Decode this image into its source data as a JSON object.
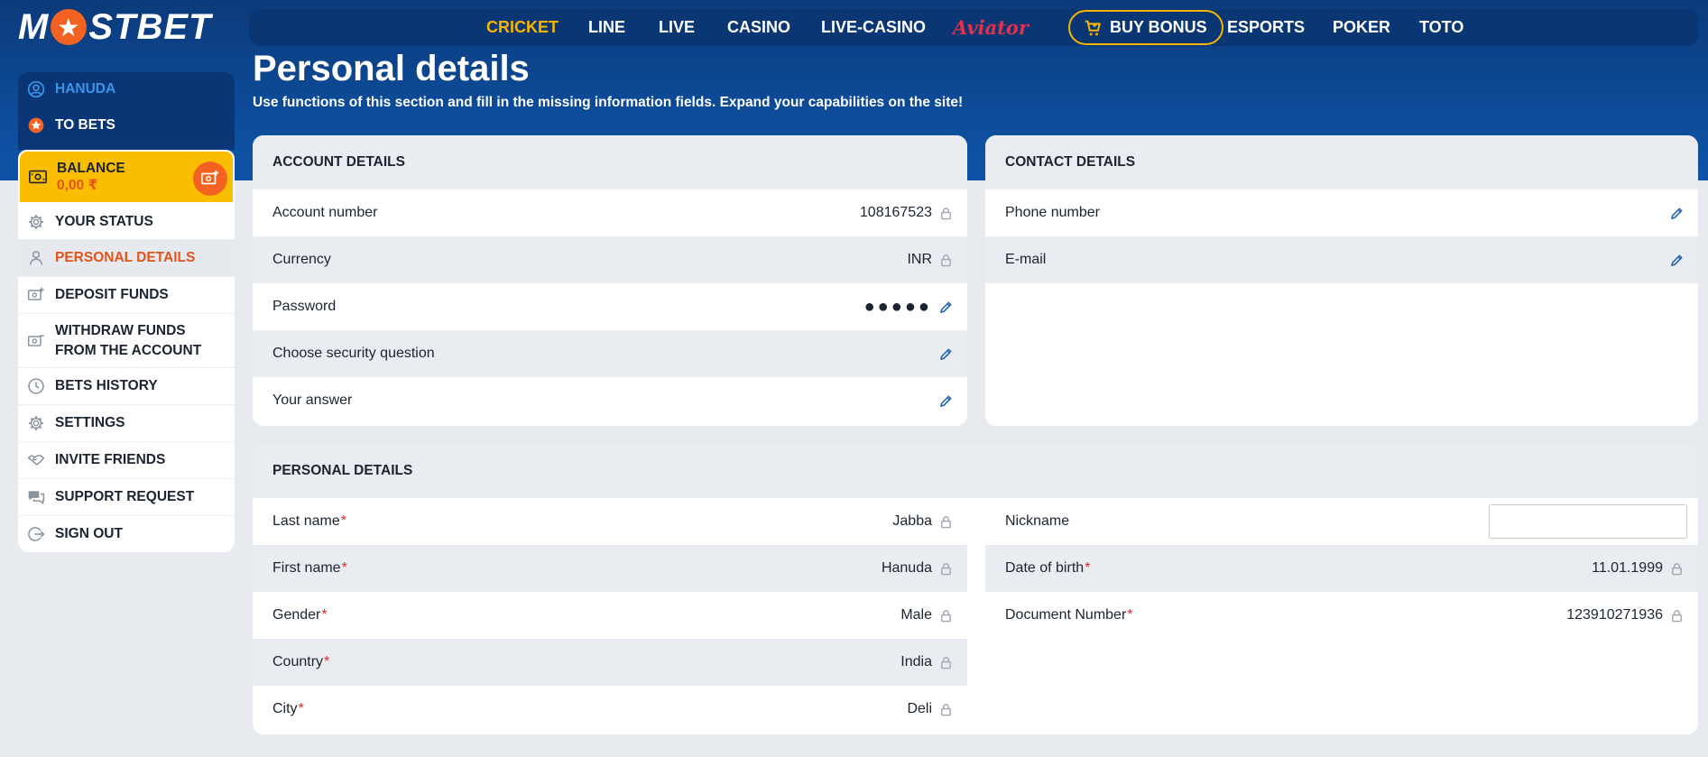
{
  "brand": {
    "logo_left": "M",
    "logo_right": "STBET"
  },
  "topnav": {
    "items": [
      {
        "label": "CRICKET",
        "active": true
      },
      {
        "label": "LINE"
      },
      {
        "label": "LIVE"
      },
      {
        "label": "CASINO"
      },
      {
        "label": "LIVE-CASINO"
      },
      {
        "label": "Aviator"
      },
      {
        "label": "BUY BONUS"
      },
      {
        "label": "ESPORTS"
      },
      {
        "label": "POKER"
      },
      {
        "label": "TOTO"
      }
    ]
  },
  "sidebar": {
    "user": "HANUDA",
    "to_bets": "TO BETS",
    "balance_label": "BALANCE",
    "balance_value": "0,00 ₹",
    "items": [
      {
        "label": "YOUR STATUS",
        "icon": "gear-icon"
      },
      {
        "label": "PERSONAL DETAILS",
        "icon": "person-icon",
        "active": true
      },
      {
        "label": "DEPOSIT FUNDS",
        "icon": "wallet-plus-icon"
      },
      {
        "label": "WITHDRAW FUNDS FROM THE ACCOUNT",
        "icon": "wallet-minus-icon"
      },
      {
        "label": "BETS HISTORY",
        "icon": "clock-icon"
      },
      {
        "label": "SETTINGS",
        "icon": "gear-icon"
      },
      {
        "label": "INVITE FRIENDS",
        "icon": "handshake-icon"
      },
      {
        "label": "SUPPORT REQUEST",
        "icon": "chat-icon"
      },
      {
        "label": "SIGN OUT",
        "icon": "sign-out-icon"
      }
    ]
  },
  "page": {
    "title": "Personal details",
    "subtitle": "Use functions of this section and fill in the missing information fields. Expand your capabilities on the site!"
  },
  "account": {
    "heading": "ACCOUNT DETAILS",
    "rows": [
      {
        "label": "Account number",
        "value": "108167523",
        "action": "lock"
      },
      {
        "label": "Currency",
        "value": "INR",
        "action": "lock"
      },
      {
        "label": "Password",
        "value": "●●●●●",
        "action": "edit"
      },
      {
        "label": "Choose security question",
        "value": "",
        "action": "edit"
      },
      {
        "label": "Your answer",
        "value": "",
        "action": "edit"
      }
    ]
  },
  "contact": {
    "heading": "CONTACT DETAILS",
    "rows": [
      {
        "label": "Phone number",
        "value": "",
        "action": "edit"
      },
      {
        "label": "E-mail",
        "value": "",
        "action": "edit"
      }
    ]
  },
  "personal": {
    "heading": "PERSONAL DETAILS",
    "left": [
      {
        "label": "Last name",
        "value": "Jabba",
        "required": true
      },
      {
        "label": "First name",
        "value": "Hanuda",
        "required": true
      },
      {
        "label": "Gender",
        "value": "Male",
        "required": true
      },
      {
        "label": "Country",
        "value": "India",
        "required": true
      },
      {
        "label": "City",
        "value": "Deli",
        "required": true
      }
    ],
    "right": [
      {
        "label": "Nickname",
        "value": ""
      },
      {
        "label": "Date of birth",
        "value": "11.01.1999",
        "required": true
      },
      {
        "label": "Document Number",
        "value": "123910271936",
        "required": true
      }
    ]
  },
  "colors": {
    "accent": "#f7b500",
    "brand_orange": "#f26322",
    "nav_bg": "#0a3673"
  }
}
